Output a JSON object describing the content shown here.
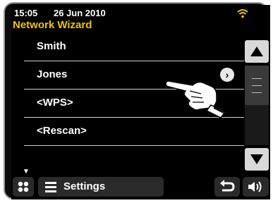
{
  "status": {
    "time": "15:05",
    "date": "26 Jun 2010",
    "wifi_icon": "wifi-icon",
    "wifi_color": "#f0c400"
  },
  "title": "Network Wizard",
  "list": {
    "items": [
      {
        "label": "Smith"
      },
      {
        "label": "Jones",
        "selected": true
      },
      {
        "label": "<WPS>"
      },
      {
        "label": "<Rescan>"
      }
    ],
    "more_indicator": "▼"
  },
  "scrollbar": {
    "up_icon": "triangle-up-icon",
    "down_icon": "triangle-down-icon"
  },
  "bottom_bar": {
    "apps_icon": "grid-icon",
    "settings_icon": "menu-lines-icon",
    "settings_label": "Settings",
    "back_icon": "back-arrow-icon",
    "volume_icon": "speaker-icon"
  },
  "colors": {
    "accent": "#f0c400",
    "background": "#000000",
    "text": "#ffffff"
  }
}
